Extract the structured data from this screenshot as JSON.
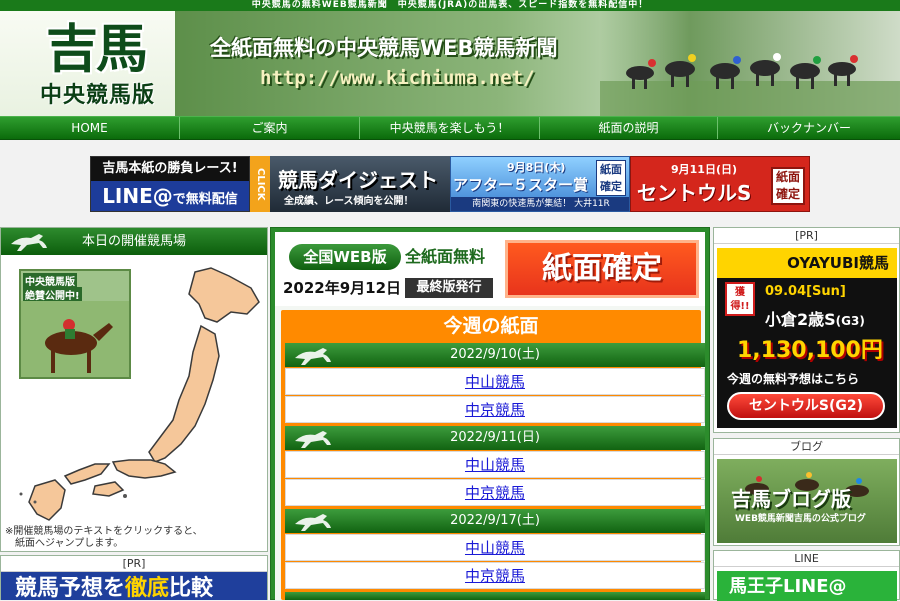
{
  "top_strip": "中央競馬の無料WEB競馬新聞　中央競馬(JRA)の出馬表、スピード指数を無料配信中！",
  "header": {
    "logo_main": "吉馬",
    "logo_sub": "中央競馬版",
    "tagline": "全紙面無料の中央競馬WEB競馬新聞",
    "url": "http://www.kichiuma.net/"
  },
  "nav": [
    "HOME",
    "ご案内",
    "中央競馬を楽しもう！",
    "紙面の説明",
    "バックナンバー"
  ],
  "banners": {
    "line": {
      "line1": "吉馬本紙の勝負レース!",
      "line2a": "LINE",
      "line2b": "@",
      "line2c": "で無料配信"
    },
    "click": "CLICK",
    "digest": {
      "title": "競馬ダイジェスト",
      "sub": "全成績、レース傾向を公開！"
    },
    "after5": {
      "date": "9月8日(木)",
      "title": "アフター５スター賞",
      "badge1": "紙面",
      "badge2": "確定",
      "sub": "南関東の快速馬が集結！ 大井11R"
    },
    "centaur": {
      "date": "9月11日(日)",
      "title": "セントウルS",
      "badge1": "紙面",
      "badge2": "確定"
    }
  },
  "left_panel": {
    "title": "本日の開催競馬場",
    "photo_caption1": "中央競馬版",
    "photo_caption2": "絶賛公開中!",
    "note": "※開催競馬場のテキストをクリックすると、\n　紙面へジャンプします。",
    "pr_label": "[PR]",
    "ad_text_a": "競馬予想を",
    "ad_text_b": "徹底",
    "ad_text_c": "比較"
  },
  "center": {
    "web_badge": "全国WEB版",
    "free_label": "全紙面無料",
    "date": "2022年9月12日",
    "final_label": "最終版発行",
    "confirmed": "紙面確定",
    "week_title": "今週の紙面",
    "dates": [
      {
        "label": "2022/9/10(土)",
        "races": [
          "中山競馬",
          "中京競馬"
        ]
      },
      {
        "label": "2022/9/11(日)",
        "races": [
          "中山競馬",
          "中京競馬"
        ]
      },
      {
        "label": "2022/9/17(土)",
        "races": [
          "中山競馬",
          "中京競馬"
        ]
      }
    ]
  },
  "right_panel": {
    "pr_label": "[PR]",
    "oyayubi": {
      "title": "OYAYUBI競馬",
      "tag1": "獲得!!",
      "date": "09.04[Sun]",
      "race": "小倉2歳S",
      "grade": "(G3)",
      "amount": "1,130,100円",
      "free": "今週の無料予想はこちら",
      "button": "セントウルS(G2)"
    },
    "blog_label": "ブログ",
    "blog_title": "吉馬ブログ版",
    "blog_sub": "WEB競馬新聞吉馬の公式ブログ",
    "line_label": "LINE",
    "line_text": "馬王子LINE@"
  },
  "colors": {
    "brand_green": "#1a7a1a",
    "orange": "#ff8a00",
    "red": "#e8341c",
    "link_blue": "#1a1ad6"
  }
}
